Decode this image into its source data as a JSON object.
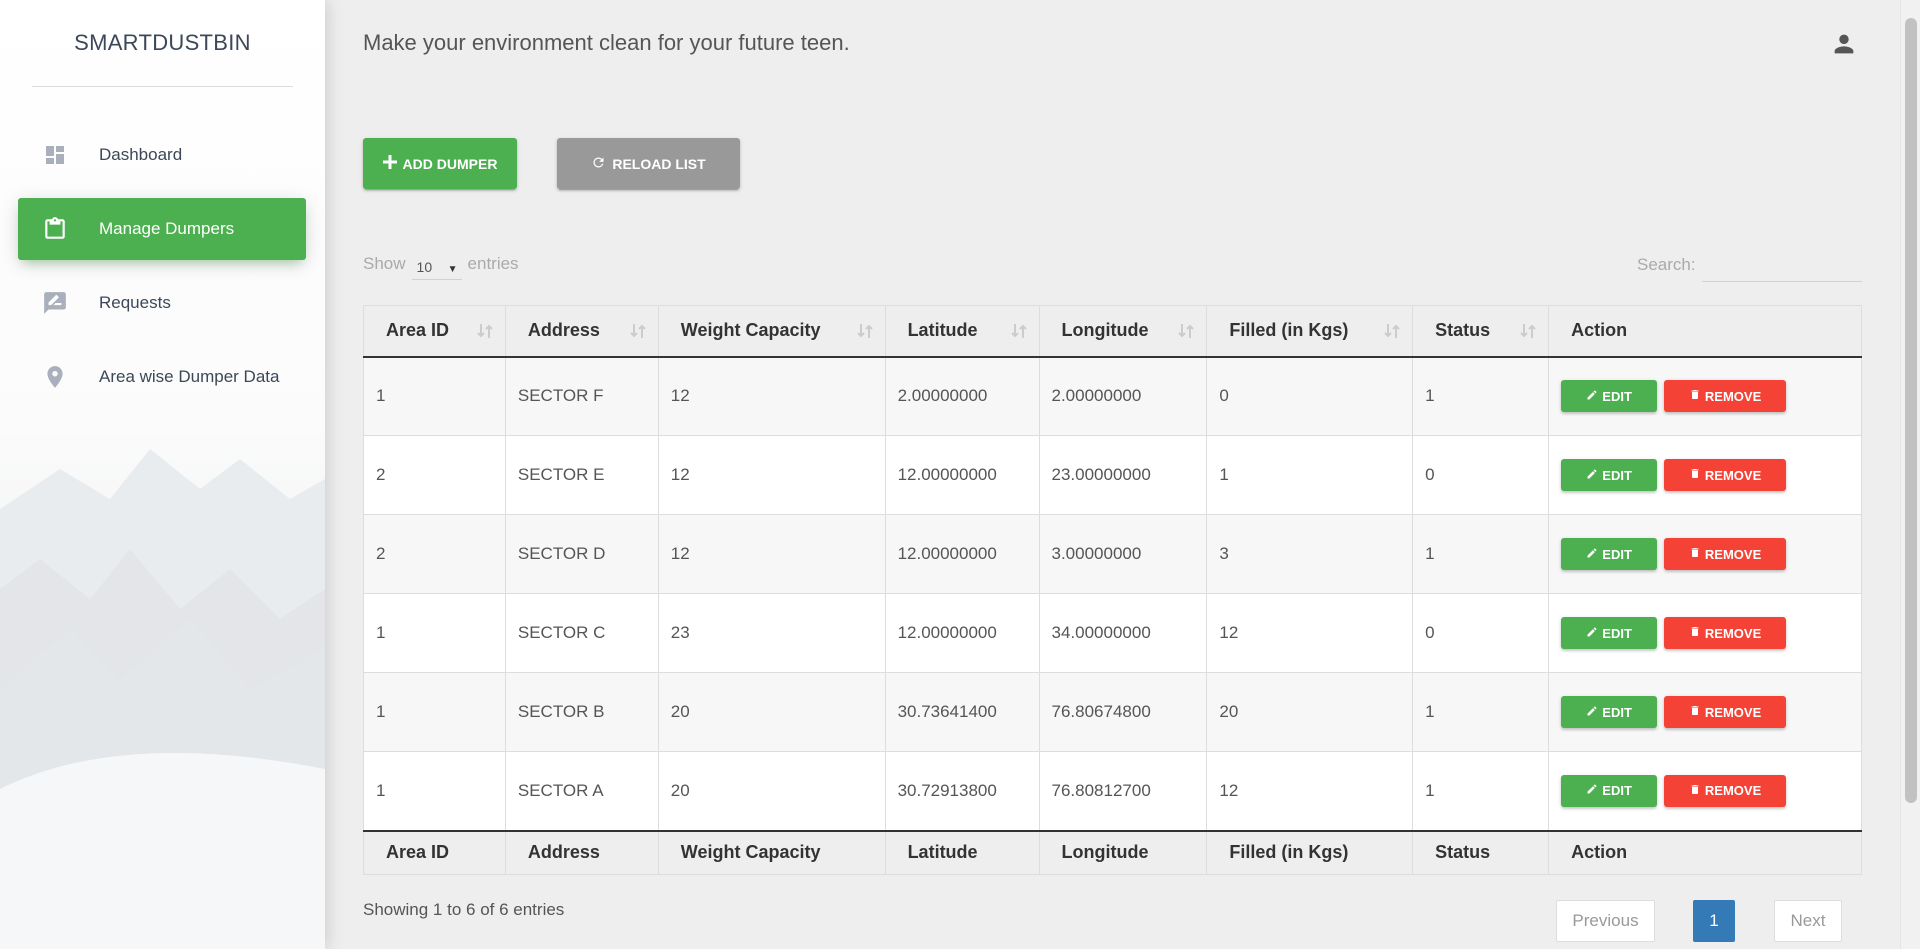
{
  "app": {
    "brand": "SMARTDUSTBIN",
    "tagline": "Make your environment clean for your future teen."
  },
  "sidebar": {
    "items": [
      {
        "label": "Dashboard",
        "icon": "dashboard-icon",
        "active": false
      },
      {
        "label": "Manage Dumpers",
        "icon": "clipboard-icon",
        "active": true
      },
      {
        "label": "Requests",
        "icon": "rate-review-icon",
        "active": false
      },
      {
        "label": "Area wise Dumper Data",
        "icon": "location-pin-icon",
        "active": false
      }
    ]
  },
  "toolbar": {
    "add_label": "ADD DUMPER",
    "reload_label": "RELOAD LIST"
  },
  "table_controls": {
    "show_label": "Show",
    "entries_value": "10",
    "entries_label": "entries",
    "search_label": "Search:",
    "search_value": ""
  },
  "table": {
    "headers": [
      "Area ID",
      "Address",
      "Weight Capacity",
      "Latitude",
      "Longitude",
      "Filled (in Kgs)",
      "Status",
      "Action"
    ],
    "rows": [
      [
        "1",
        "SECTOR F",
        "12",
        "2.00000000",
        "2.00000000",
        "0",
        "1"
      ],
      [
        "2",
        "SECTOR E",
        "12",
        "12.00000000",
        "23.00000000",
        "1",
        "0"
      ],
      [
        "2",
        "SECTOR D",
        "12",
        "12.00000000",
        "3.00000000",
        "3",
        "1"
      ],
      [
        "1",
        "SECTOR C",
        "23",
        "12.00000000",
        "34.00000000",
        "12",
        "0"
      ],
      [
        "1",
        "SECTOR B",
        "20",
        "30.73641400",
        "76.80674800",
        "20",
        "1"
      ],
      [
        "1",
        "SECTOR A",
        "20",
        "30.72913800",
        "76.80812700",
        "12",
        "1"
      ]
    ],
    "edit_label": "EDIT",
    "remove_label": "REMOVE"
  },
  "footer": {
    "info": "Showing 1 to 6 of 6 entries",
    "previous": "Previous",
    "page": "1",
    "next": "Next"
  },
  "colors": {
    "primary": "#4caf50",
    "danger": "#f44336",
    "neutral": "#999999",
    "pagination": "#337ab7"
  }
}
